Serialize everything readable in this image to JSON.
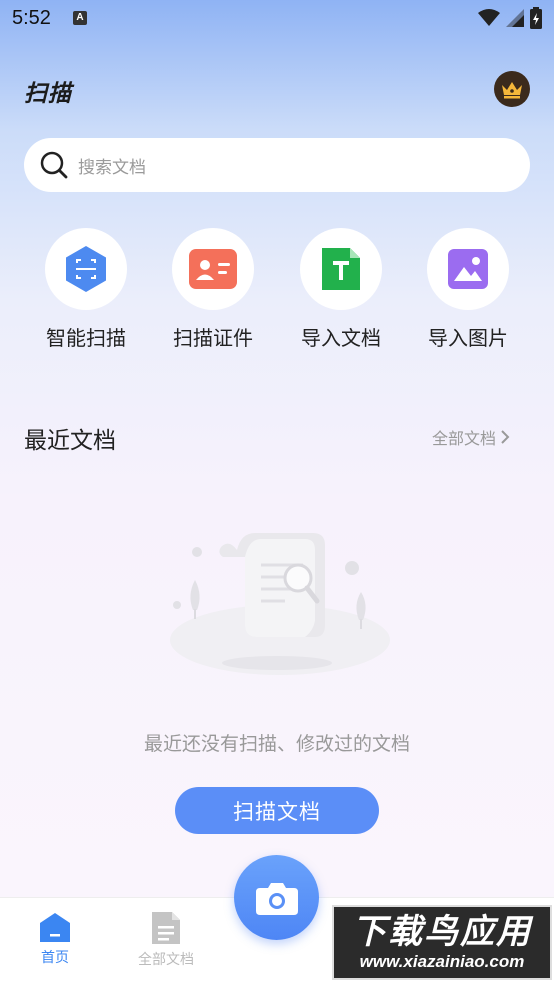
{
  "status_bar": {
    "time": "5:52",
    "notification_icon_letter": "A",
    "icons": [
      "wifi-icon",
      "signal-icon",
      "battery-icon"
    ]
  },
  "header": {
    "title": "扫描",
    "vip_icon": "crown-icon"
  },
  "search": {
    "placeholder": "搜索文档",
    "icon": "search-icon"
  },
  "quick_actions": [
    {
      "label": "智能扫描",
      "icon": "smart-scan-icon",
      "color": "#4d8af0"
    },
    {
      "label": "扫描证件",
      "icon": "id-card-icon",
      "color": "#f4705a"
    },
    {
      "label": "导入文档",
      "icon": "import-doc-icon",
      "color": "#22b14c"
    },
    {
      "label": "导入图片",
      "icon": "import-image-icon",
      "color": "#9b6cf0"
    }
  ],
  "recent": {
    "title": "最近文档",
    "all_link": "全部文档"
  },
  "empty_state": {
    "message": "最近还没有扫描、修改过的文档",
    "button_label": "扫描文档"
  },
  "bottom_nav": {
    "items": [
      {
        "label": "首页",
        "icon": "home-icon",
        "active": true
      },
      {
        "label": "全部文档",
        "icon": "documents-icon",
        "active": false
      }
    ],
    "camera_icon": "camera-icon"
  },
  "watermark": {
    "main": "下载鸟应用",
    "url": "www.xiazainiao.com"
  },
  "colors": {
    "accent": "#5b8ef7",
    "inactive": "#bbbbbb"
  }
}
